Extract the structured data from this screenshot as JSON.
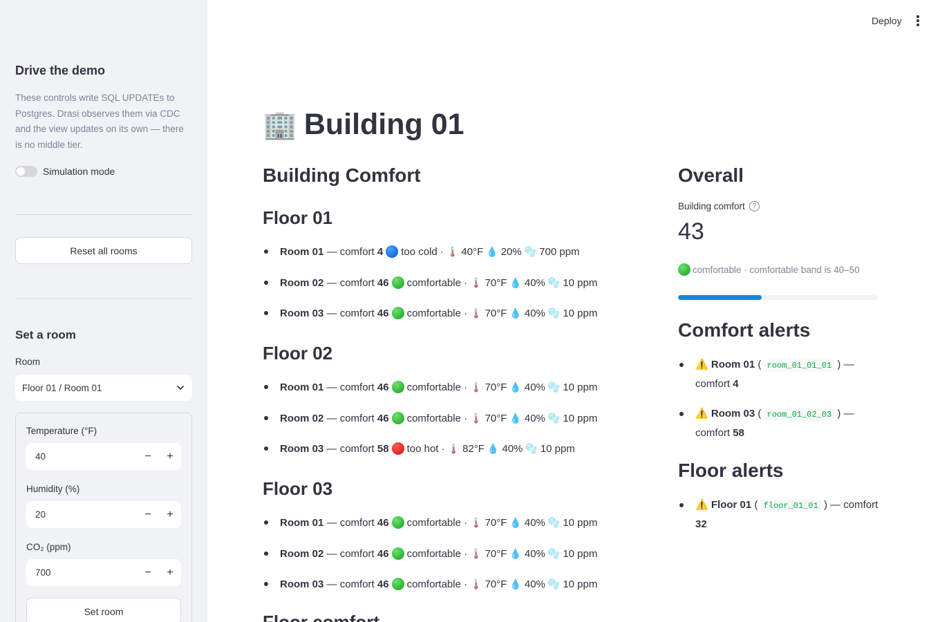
{
  "sidebar": {
    "title": "Drive the demo",
    "description": "These controls write SQL UPDATEs to Postgres. Drasi observes them via CDC and the view updates on its own — there is no middle tier.",
    "simulation_label": "Simulation mode",
    "simulation_on": false,
    "reset_label": "Reset all rooms",
    "set_room_heading": "Set a room",
    "room_label": "Room",
    "room_selected": "Floor 01 / Room 01",
    "temperature_label": "Temperature (°F)",
    "temperature_value": "40",
    "humidity_label": "Humidity (%)",
    "humidity_value": "20",
    "co2_label": "CO₂ (ppm)",
    "co2_value": "700",
    "set_room_label": "Set room"
  },
  "header": {
    "deploy_label": "Deploy"
  },
  "main": {
    "title_emoji": "🏢",
    "title": "Building 01",
    "section_heading": "Building Comfort",
    "next_heading": "Floor comfort",
    "floors": [
      {
        "name": "Floor 01",
        "rooms": [
          {
            "name": "Room 01",
            "comfort": "4",
            "status_color": "blue",
            "status": "too cold",
            "temp": "40°F",
            "humidity": "20%",
            "co2": "700 ppm"
          },
          {
            "name": "Room 02",
            "comfort": "46",
            "status_color": "green",
            "status": "comfortable",
            "temp": "70°F",
            "humidity": "40%",
            "co2": "10 ppm"
          },
          {
            "name": "Room 03",
            "comfort": "46",
            "status_color": "green",
            "status": "comfortable",
            "temp": "70°F",
            "humidity": "40%",
            "co2": "10 ppm"
          }
        ]
      },
      {
        "name": "Floor 02",
        "rooms": [
          {
            "name": "Room 01",
            "comfort": "46",
            "status_color": "green",
            "status": "comfortable",
            "temp": "70°F",
            "humidity": "40%",
            "co2": "10 ppm"
          },
          {
            "name": "Room 02",
            "comfort": "46",
            "status_color": "green",
            "status": "comfortable",
            "temp": "70°F",
            "humidity": "40%",
            "co2": "10 ppm"
          },
          {
            "name": "Room 03",
            "comfort": "58",
            "status_color": "red",
            "status": "too hot",
            "temp": "82°F",
            "humidity": "40%",
            "co2": "10 ppm"
          }
        ]
      },
      {
        "name": "Floor 03",
        "rooms": [
          {
            "name": "Room 01",
            "comfort": "46",
            "status_color": "green",
            "status": "comfortable",
            "temp": "70°F",
            "humidity": "40%",
            "co2": "10 ppm"
          },
          {
            "name": "Room 02",
            "comfort": "46",
            "status_color": "green",
            "status": "comfortable",
            "temp": "70°F",
            "humidity": "40%",
            "co2": "10 ppm"
          },
          {
            "name": "Room 03",
            "comfort": "46",
            "status_color": "green",
            "status": "comfortable",
            "temp": "70°F",
            "humidity": "40%",
            "co2": "10 ppm"
          }
        ]
      }
    ]
  },
  "overall": {
    "heading": "Overall",
    "metric_label": "Building comfort",
    "metric_value": "43",
    "caption": "comfortable · comfortable band is 40–50",
    "progress_fraction": 0.42,
    "progress_color": "#1c83e1"
  },
  "comfort_alerts": {
    "heading": "Comfort alerts",
    "items": [
      {
        "name": "Room 01",
        "id": "room_01_01_01",
        "comfort": "4"
      },
      {
        "name": "Room 03",
        "id": "room_01_02_03",
        "comfort": "58"
      }
    ]
  },
  "floor_alerts": {
    "heading": "Floor alerts",
    "items": [
      {
        "name": "Floor 01",
        "id": "floor_01_01",
        "comfort": "32"
      }
    ]
  },
  "labels": {
    "comfort_word": "comfort",
    "sep": "·",
    "dash": "—"
  }
}
